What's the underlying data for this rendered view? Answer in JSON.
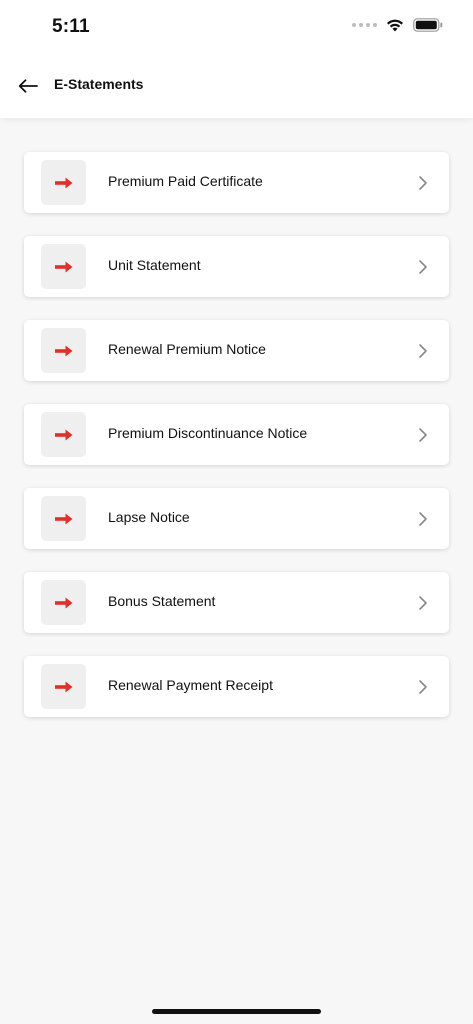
{
  "status_bar": {
    "time": "5:11"
  },
  "header": {
    "title": "E-Statements"
  },
  "items": [
    {
      "label": "Premium Paid Certificate"
    },
    {
      "label": "Unit Statement"
    },
    {
      "label": "Renewal Premium Notice"
    },
    {
      "label": "Premium Discontinuance Notice"
    },
    {
      "label": "Lapse Notice"
    },
    {
      "label": "Bonus Statement"
    },
    {
      "label": "Renewal Payment Receipt"
    }
  ],
  "icons": {
    "back": "arrow-left-icon",
    "item": "arrow-right-icon",
    "chevron": "chevron-right-icon"
  },
  "colors": {
    "accent_arrow": "#e0302a",
    "background": "#f7f7f7",
    "card": "#ffffff",
    "icon_tile": "#efefef"
  }
}
